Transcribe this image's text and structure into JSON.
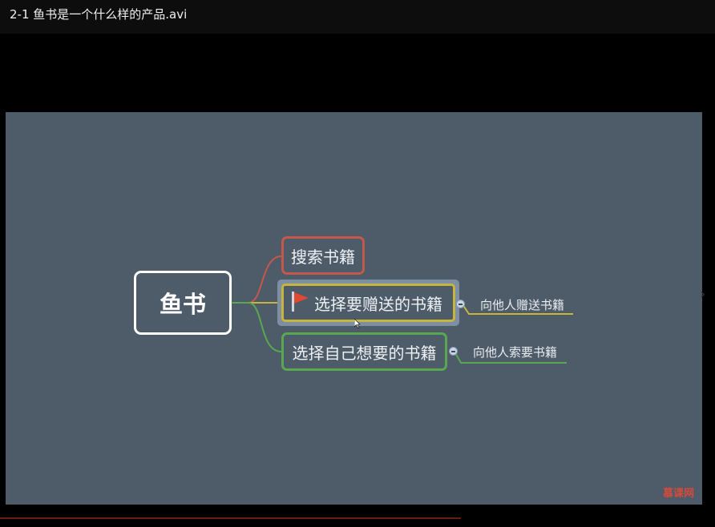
{
  "window": {
    "title": "2-1 鱼书是一个什么样的产品.avi"
  },
  "mindmap": {
    "root": "鱼书",
    "branches": [
      {
        "label": "搜索书籍"
      },
      {
        "label": "选择要赠送的书籍",
        "child": "向他人赠送书籍",
        "icon": "red-flag-icon"
      },
      {
        "label": "选择自己想要的书籍",
        "child": "向他人索要书籍"
      }
    ]
  },
  "watermark": {
    "text": "慕课网"
  },
  "colors": {
    "slide_bg": "#4e5b69",
    "branch_red": "#c3594c",
    "branch_yellow": "#c7b53d",
    "branch_green": "#58a852"
  }
}
